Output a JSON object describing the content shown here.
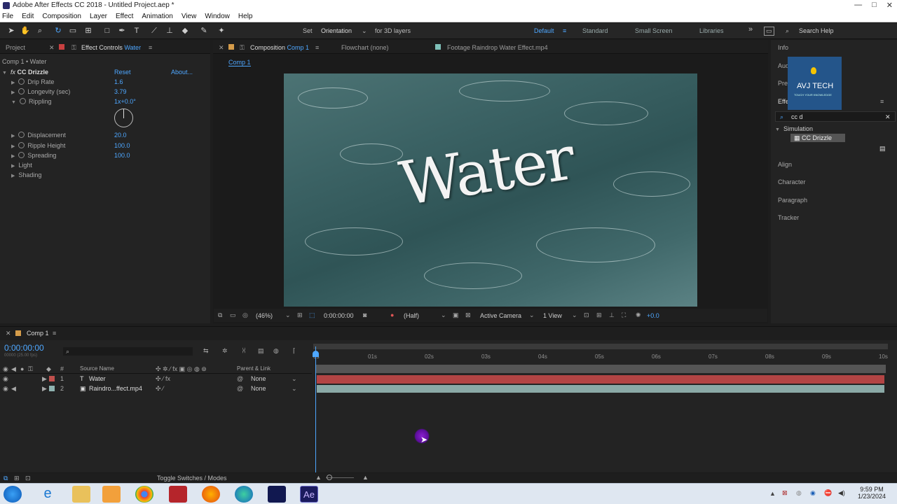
{
  "window": {
    "title": "Adobe After Effects CC 2018 - Untitled Project.aep *",
    "min": "—",
    "max": "□",
    "close": "✕"
  },
  "menu": [
    "File",
    "Edit",
    "Composition",
    "Layer",
    "Effect",
    "Animation",
    "View",
    "Window",
    "Help"
  ],
  "toolbar": {
    "set_label": "Set",
    "orientation": "Orientation",
    "for3d": "for 3D layers",
    "workspaces": [
      "Default",
      "Standard",
      "Small Screen",
      "Libraries"
    ],
    "search_placeholder": "Search Help",
    "more": "»"
  },
  "left_panel": {
    "tab_project": "Project",
    "tab_effect_controls": "Effect Controls",
    "effect_target": "Water",
    "breadcrumb": "Comp 1 • Water",
    "effect_name": "CC Drizzle",
    "reset": "Reset",
    "about": "About...",
    "params": [
      {
        "label": "Drip Rate",
        "value": "1.6"
      },
      {
        "label": "Longevity (sec)",
        "value": "3.79"
      },
      {
        "label": "Rippling",
        "value": "1x+0.0°"
      },
      {
        "label": "Displacement",
        "value": "20.0"
      },
      {
        "label": "Ripple Height",
        "value": "100.0"
      },
      {
        "label": "Spreading",
        "value": "100.0"
      }
    ],
    "groups": [
      "Light",
      "Shading"
    ]
  },
  "comp_panel": {
    "tab_composition": "Composition",
    "comp_name": "Comp 1",
    "flowchart": "Flowchart (none)",
    "footage": "Footage Raindrop Water Effect.mp4",
    "sub_tab": "Comp 1",
    "overlay_text": "Water"
  },
  "comp_controls": {
    "zoom": "(46%)",
    "timecode": "0:00:00:00",
    "resolution": "(Half)",
    "camera": "Active Camera",
    "views": "1 View",
    "exposure": "+0.0"
  },
  "right_panel": {
    "items": [
      "Info",
      "Audio",
      "Preview",
      "Effects & Presets"
    ],
    "search_value": "cc d",
    "category": "Simulation",
    "result": "CC Drizzle",
    "sections": [
      "Align",
      "Character",
      "Paragraph",
      "Tracker"
    ],
    "watermark_line1": "AVJ TECH",
    "watermark_line2": "TOUCH YOUR KNOWLEDGE"
  },
  "timeline": {
    "tab": "Comp 1",
    "timecode": "0:00:00:00",
    "fps": "00000 (25.00 fps)",
    "col_source": "Source Name",
    "col_parent": "Parent & Link",
    "col_num": "#",
    "layers": [
      {
        "num": "1",
        "name": "Water",
        "type": "T",
        "parent": "None",
        "color": "#c0504d"
      },
      {
        "num": "2",
        "name": "Raindro...ffect.mp4",
        "type": "▣",
        "parent": "None",
        "color": "#8fb3b0"
      }
    ],
    "ticks": [
      "0s",
      "01s",
      "02s",
      "03s",
      "04s",
      "05s",
      "06s",
      "07s",
      "08s",
      "09s",
      "10s"
    ],
    "toggle": "Toggle Switches / Modes"
  },
  "taskbar": {
    "time": "9:59 PM",
    "date": "1/23/2024",
    "ae_label": "Ae"
  },
  "colors": {
    "accent": "#4ea7ff",
    "layer1": "#b24444",
    "layer2": "#8aa9a6"
  }
}
